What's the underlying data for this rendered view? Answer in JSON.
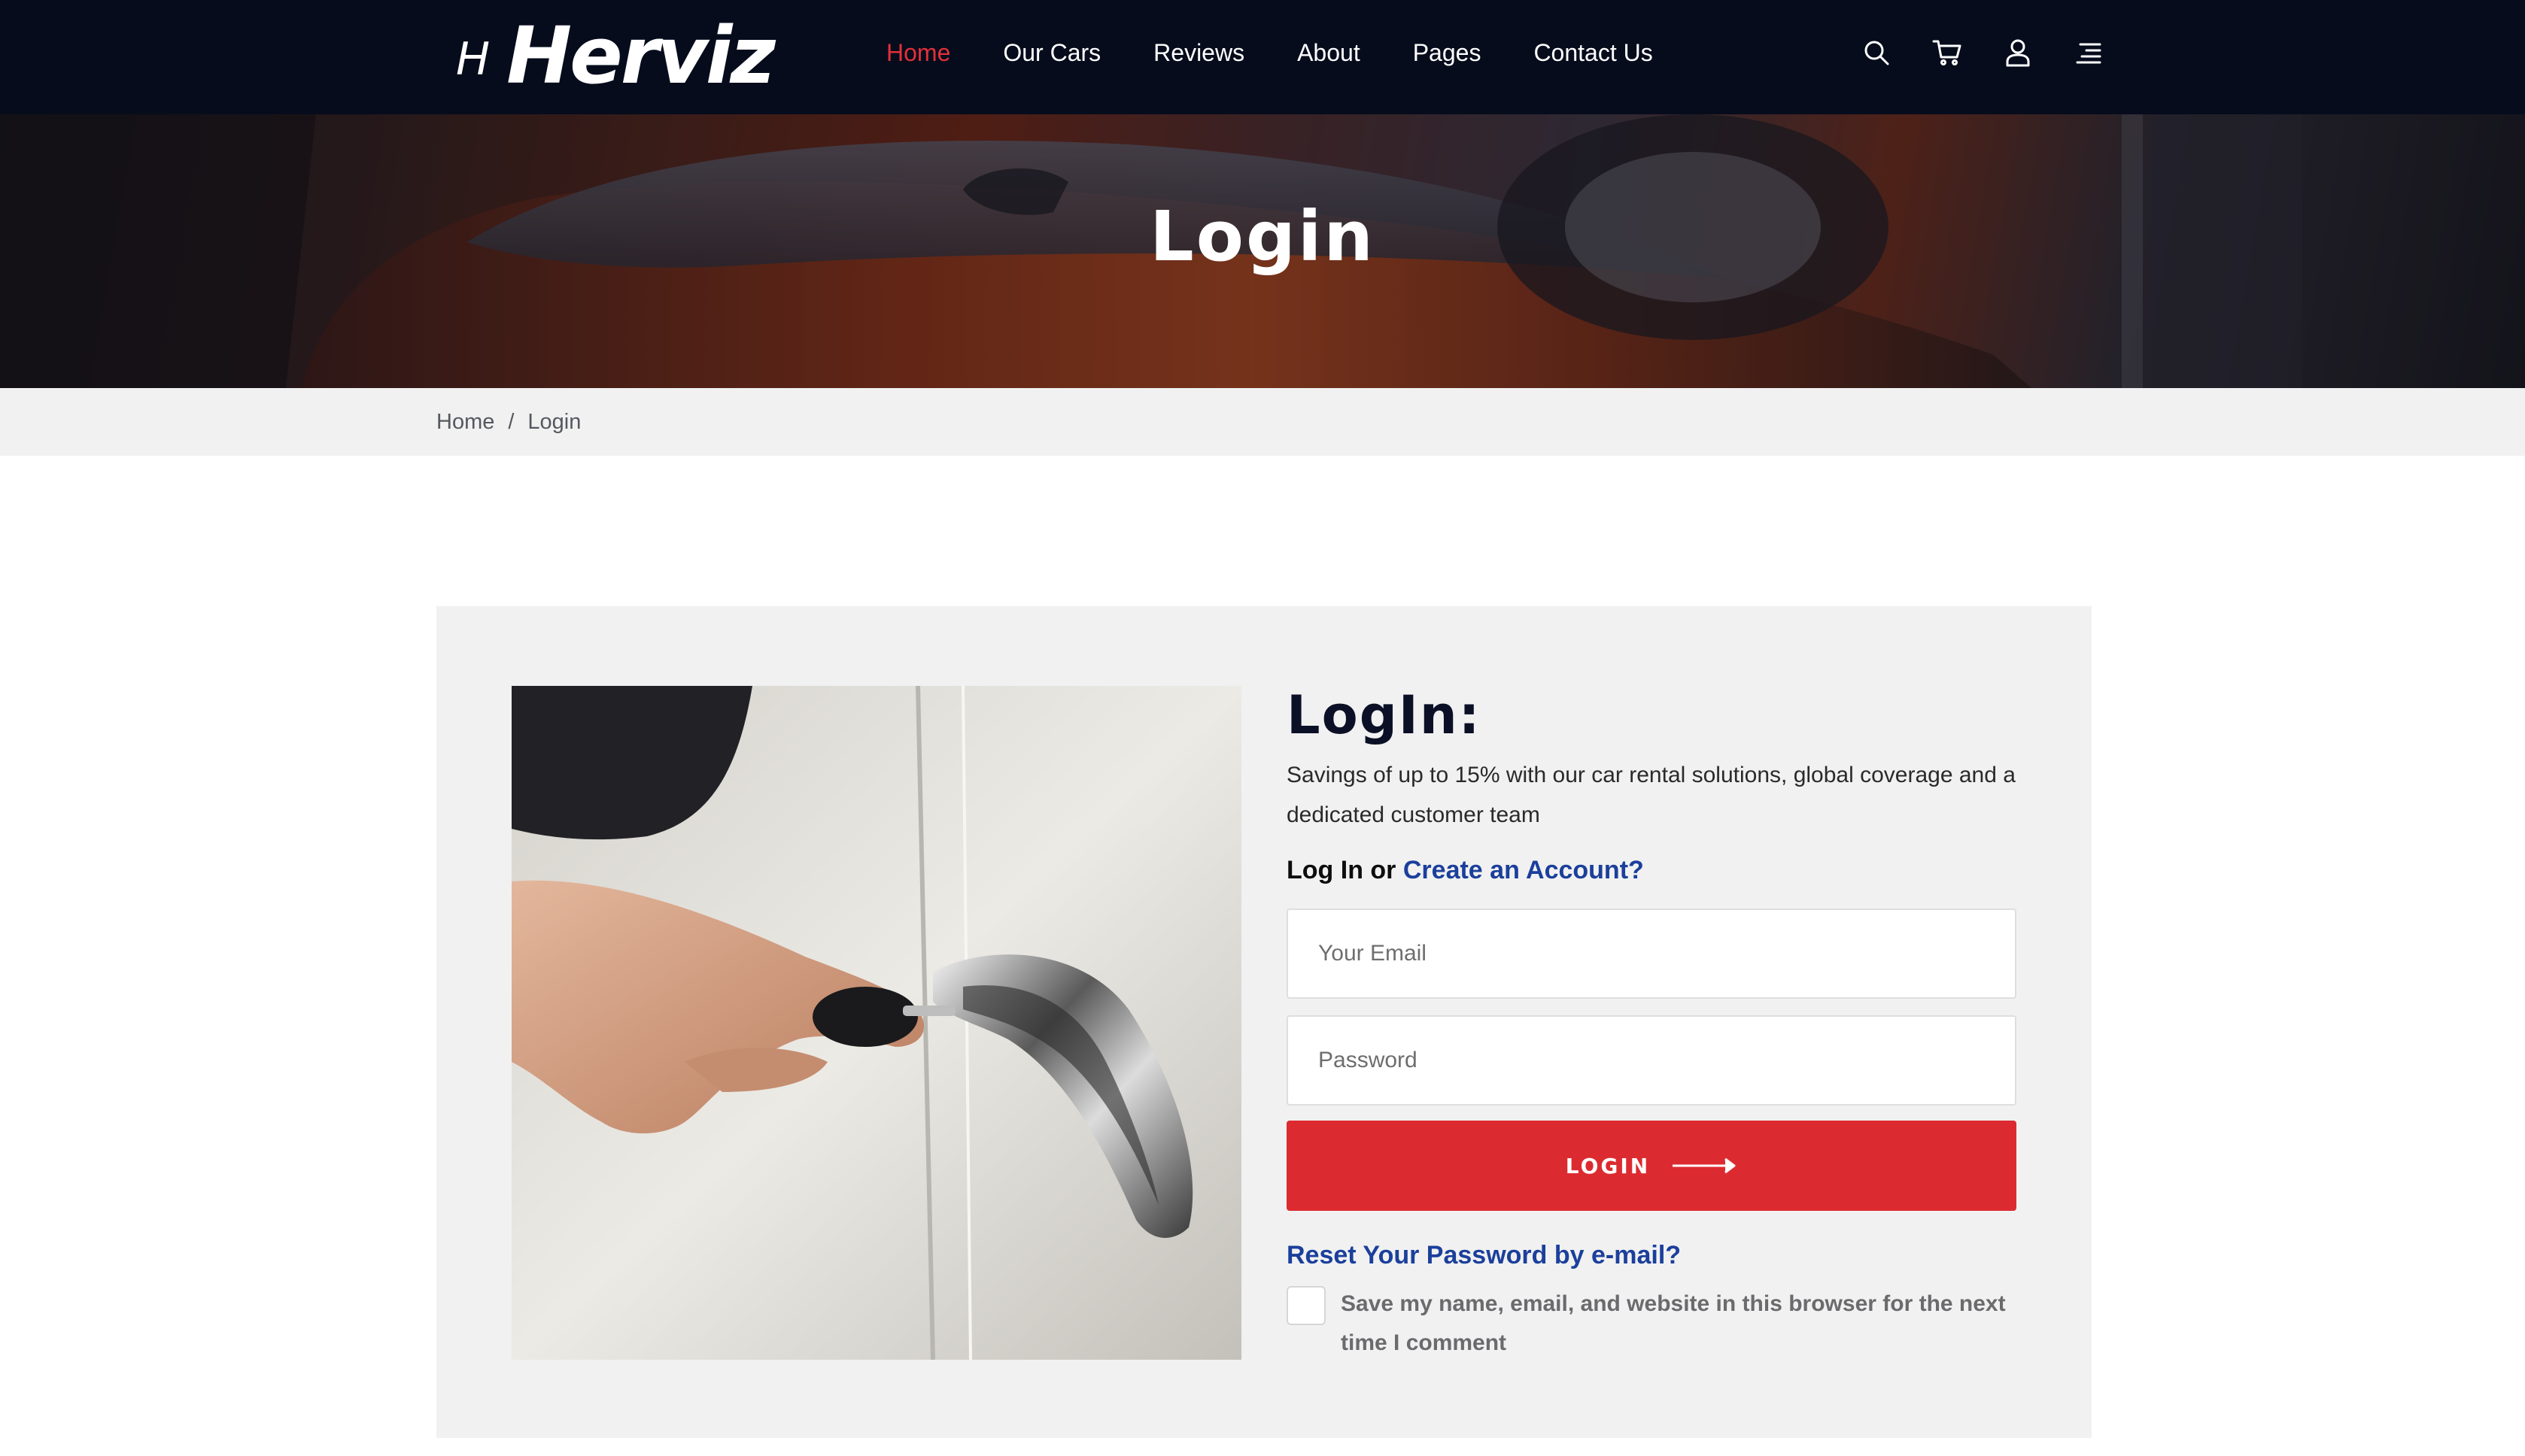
{
  "brand": {
    "mark": "H",
    "name": "Herviz"
  },
  "nav": {
    "items": [
      {
        "label": "Home",
        "active": true
      },
      {
        "label": "Our Cars",
        "active": false
      },
      {
        "label": "Reviews",
        "active": false
      },
      {
        "label": "About",
        "active": false
      },
      {
        "label": "Pages",
        "active": false
      },
      {
        "label": "Contact Us",
        "active": false
      }
    ],
    "active_color": "#e2303a"
  },
  "header_icons": [
    "search-icon",
    "cart-icon",
    "user-icon",
    "menu-icon"
  ],
  "hero": {
    "title": "Login"
  },
  "breadcrumb": {
    "home": "Home",
    "separator": "/",
    "current": "Login"
  },
  "login": {
    "title": "LogIn:",
    "description": "Savings of up to 15% with our car rental solutions, global coverage and a dedicated customer team",
    "cta_prefix": "Log In or",
    "cta_link": "Create an Account?",
    "email_placeholder": "Your Email",
    "password_placeholder": "Password",
    "submit_label": "LOGIN",
    "reset_link": "Reset Your Password by e-mail?",
    "remember_label": "Save my name, email, and website in this browser for the next time I comment"
  },
  "colors": {
    "header_bg": "#060c1c",
    "accent_red": "#dc2b30",
    "link_blue": "#1b3f9b",
    "panel_bg": "#f1f1f1"
  }
}
